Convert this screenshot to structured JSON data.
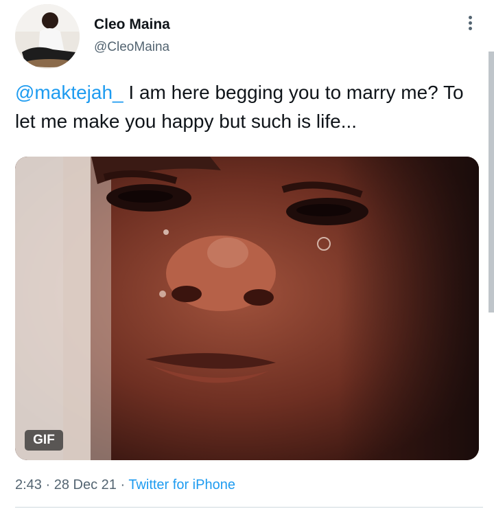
{
  "tweet": {
    "author_name": "Cleo Maina",
    "author_handle": "@CleoMaina",
    "mention": "@maktejah_",
    "text": " I am here begging you to marry me? To let me make you happy but such is life...",
    "media_badge": "GIF",
    "time": "2:43",
    "separator": " · ",
    "date": "28 Dec 21",
    "source": "Twitter for iPhone"
  },
  "icons": {
    "more": "more-options-icon"
  },
  "colors": {
    "accent": "#1d9bf0",
    "text": "#0f1419",
    "secondary": "#536471"
  }
}
